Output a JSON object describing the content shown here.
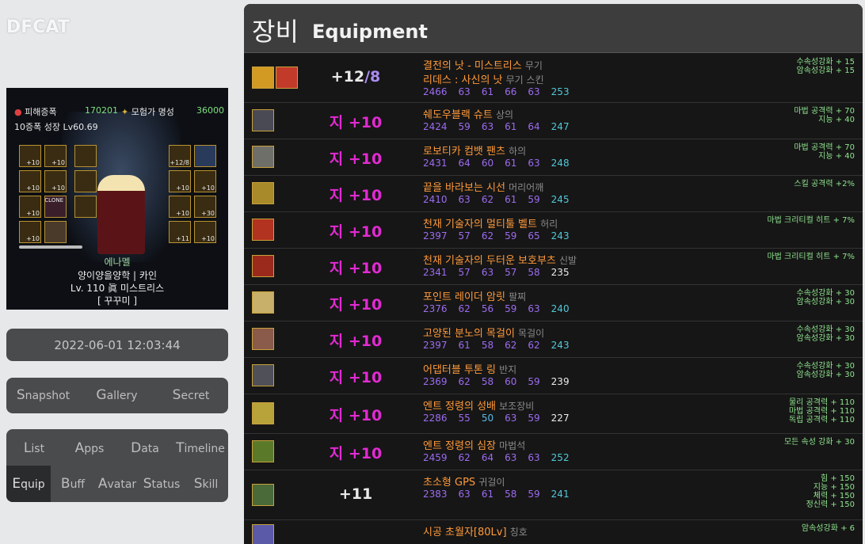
{
  "brand": "DFCAT",
  "character": {
    "stat1_label": "피해증폭",
    "stat1_value": "170201",
    "stat2_label": "모험가 명성",
    "stat2_value": "36000",
    "growth": "10증폭 성장 Lv60.69",
    "weapon_slot_label": "+12/8",
    "slot_labels": [
      "+10",
      "+10",
      "+10",
      "+10",
      "+10",
      "+10",
      "+10",
      "+10",
      "+10",
      "+30",
      "+10",
      "+11",
      "+10"
    ],
    "clone_label": "CLONE",
    "name": "에나멜",
    "guild": "양이양을양학 | 카인",
    "level_class": "Lv. 110 眞 미스트리스",
    "title_tag": "[ 꾸꾸미 ]"
  },
  "timestamp": "2022-06-01 12:03:44",
  "nav1": {
    "items": [
      {
        "cap": "S",
        "rest": "napshot"
      },
      {
        "cap": "G",
        "rest": "allery"
      },
      {
        "cap": "S",
        "rest": "ecret"
      }
    ]
  },
  "nav2": {
    "items": [
      {
        "cap": "L",
        "rest": "ist"
      },
      {
        "cap": "A",
        "rest": "pps"
      },
      {
        "cap": "D",
        "rest": "ata"
      },
      {
        "cap": "T",
        "rest": "imeline"
      },
      {
        "cap": "E",
        "rest": "quip"
      },
      {
        "cap": "B",
        "rest": "uff"
      },
      {
        "cap": "A",
        "rest": "vatar"
      },
      {
        "cap": "S",
        "rest": "tatus"
      },
      {
        "cap": "S",
        "rest": "kill"
      }
    ]
  },
  "header": {
    "ko": "장비",
    "en": "Equipment"
  },
  "equipment": [
    {
      "enh_text": "+12",
      "amp_text": "/8",
      "enh_style": "plain",
      "name": "결전의 낫 - 미스트리스",
      "type": "무기",
      "name2": "리데스 : 사신의 낫",
      "type2": "무기 스킨",
      "stats": [
        "2466",
        "63",
        "61",
        "66",
        "63",
        "253"
      ],
      "opts": [
        "수속성강화 + 15",
        "암속성강화 + 15"
      ],
      "icon_color": "#d29a22",
      "icon2_color": "#c23a2a"
    },
    {
      "enh_text": "지 +10",
      "enh_style": "mag",
      "name": "쉐도우블랙 슈트",
      "type": "상의",
      "stats": [
        "2424",
        "59",
        "63",
        "61",
        "64",
        "247"
      ],
      "opts": [
        "마법 공격력 + 70",
        "지능 + 40"
      ],
      "icon_color": "#4a4a55"
    },
    {
      "enh_text": "지 +10",
      "enh_style": "mag",
      "name": "로보티카 컴뱃 팬츠",
      "type": "하의",
      "stats": [
        "2431",
        "64",
        "60",
        "61",
        "63",
        "248"
      ],
      "opts": [
        "마법 공격력 + 70",
        "지능 + 40"
      ],
      "icon_color": "#6f6f6a"
    },
    {
      "enh_text": "지 +10",
      "enh_style": "mag",
      "name": "끝을 바라보는 시선",
      "type": "머리어깨",
      "stats": [
        "2410",
        "63",
        "62",
        "61",
        "59",
        "245"
      ],
      "opts": [
        "스킬 공격력 +2%"
      ],
      "icon_color": "#a88a2a"
    },
    {
      "enh_text": "지 +10",
      "enh_style": "mag",
      "name": "천재 기술자의 멀티툴 벨트",
      "type": "허리",
      "stats": [
        "2397",
        "57",
        "62",
        "59",
        "65",
        "243"
      ],
      "opts": [
        "마법 크리티컬 히트 + 7%"
      ],
      "icon_color": "#b2331f"
    },
    {
      "enh_text": "지 +10",
      "enh_style": "mag",
      "name": "천재 기술자의 두터운 보호부츠",
      "type": "신발",
      "stats": [
        "2341",
        "57",
        "63",
        "57",
        "58",
        "235"
      ],
      "opts": [
        "마법 크리티컬 히트 + 7%"
      ],
      "icon_color": "#9c2a1c"
    },
    {
      "enh_text": "지 +10",
      "enh_style": "mag",
      "name": "포인트 레이더 암릿",
      "type": "팔찌",
      "stats": [
        "2376",
        "62",
        "56",
        "59",
        "63",
        "240"
      ],
      "opts": [
        "수속성강화 + 30",
        "암속성강화 + 30"
      ],
      "icon_color": "#c8b06a"
    },
    {
      "enh_text": "지 +10",
      "enh_style": "mag",
      "name": "고양된 분노의 목걸이",
      "type": "목걸이",
      "stats": [
        "2397",
        "61",
        "58",
        "62",
        "62",
        "243"
      ],
      "opts": [
        "수속성강화 + 30",
        "암속성강화 + 30"
      ],
      "icon_color": "#8a5a4a"
    },
    {
      "enh_text": "지 +10",
      "enh_style": "mag",
      "name": "어댑터블 투톤 링",
      "type": "반지",
      "stats": [
        "2369",
        "62",
        "58",
        "60",
        "59",
        "239"
      ],
      "opts": [
        "수속성강화 + 30",
        "암속성강화 + 30"
      ],
      "icon_color": "#505058"
    },
    {
      "enh_text": "지 +10",
      "enh_style": "mag",
      "name": "엔트 정령의 성배",
      "type": "보조장비",
      "stats": [
        "2286",
        "55",
        "50",
        "63",
        "59",
        "227"
      ],
      "opts": [
        "물리 공격력 + 110",
        "마법 공격력 + 110",
        "독립 공격력 + 110"
      ],
      "icon_color": "#b8a23a"
    },
    {
      "enh_text": "지 +10",
      "enh_style": "mag",
      "name": "엔트 정령의 심장",
      "type": "마법석",
      "stats": [
        "2459",
        "62",
        "64",
        "63",
        "63",
        "252"
      ],
      "opts": [
        "모든 속성 강화 + 30"
      ],
      "icon_color": "#5a7a2a"
    },
    {
      "enh_text": "+11",
      "enh_style": "plain",
      "name": "초소형 GPS",
      "type": "귀걸이",
      "stats": [
        "2383",
        "63",
        "61",
        "58",
        "59",
        "241"
      ],
      "opts": [
        "힘 + 150",
        "지능 + 150",
        "체력 + 150",
        "정신력 + 150"
      ],
      "icon_color": "#4a6a3a"
    },
    {
      "enh_text": "",
      "enh_style": "plain",
      "name": "시공 초월자[80Lv]",
      "type": "칭호",
      "stats": [],
      "opts": [
        "암속성강화 + 6"
      ],
      "icon_color": "#5a5aa8"
    }
  ]
}
